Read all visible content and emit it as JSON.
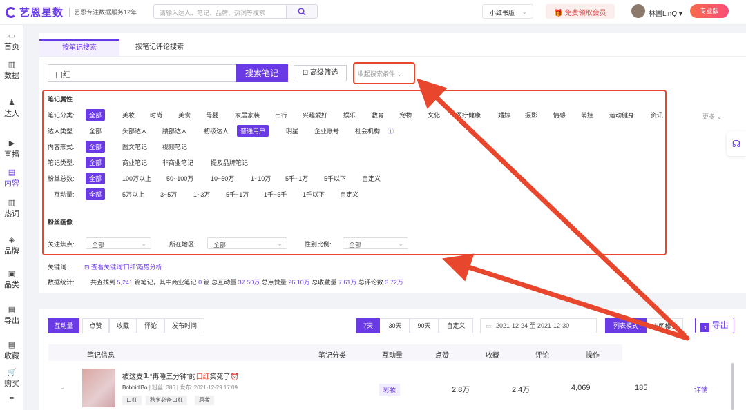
{
  "header": {
    "logo": "艺恩星数",
    "slogan": "艺恩专注数据服务12年",
    "search_placeholder": "请输入达人、笔记、品牌、热词等搜索",
    "platform": "小红书版",
    "vip": "免费领取会员",
    "user": "林圃LinQ",
    "pro_badge": "专业版"
  },
  "sidebar": [
    {
      "label": "首页",
      "icon": "monitor-icon"
    },
    {
      "label": "数据",
      "icon": "bar-chart-icon"
    },
    {
      "label": "达人",
      "icon": "person-icon"
    },
    {
      "label": "直播",
      "icon": "play-icon"
    },
    {
      "label": "内容",
      "icon": "document-icon"
    },
    {
      "label": "热词",
      "icon": "trend-icon"
    },
    {
      "label": "品牌",
      "icon": "diamond-icon"
    },
    {
      "label": "品类",
      "icon": "box-icon"
    },
    {
      "label": "导出",
      "icon": "export-icon"
    },
    {
      "label": "收藏",
      "icon": "bookmark-icon"
    },
    {
      "label": "购买",
      "icon": "cart-icon"
    },
    {
      "label": "",
      "icon": "list-icon"
    }
  ],
  "tabs": [
    "按笔记搜索",
    "按笔记评论搜索"
  ],
  "search": {
    "keyword": "口红",
    "search_btn": "搜索笔记",
    "advanced_btn": "高级筛选",
    "collapse": "收起搜索条件"
  },
  "filters": {
    "section_title": "笔记属性",
    "category": {
      "label": "笔记分类:",
      "options": [
        "全部",
        "美妆",
        "时尚",
        "美食",
        "母婴",
        "家居家装",
        "出行",
        "兴趣爱好",
        "娱乐",
        "教育",
        "宠物",
        "文化",
        "医疗健康",
        "婚嫁",
        "摄影",
        "情感",
        "萌娃",
        "运动健身",
        "资讯"
      ],
      "more": "更多"
    },
    "talent": {
      "label": "达人类型:",
      "options": [
        "全部",
        "头部达人",
        "腰部达人",
        "初级达人",
        "普通用户",
        "明星",
        "企业账号",
        "社会机构"
      ]
    },
    "format": {
      "label": "内容形式:",
      "options": [
        "全部",
        "图文笔记",
        "视频笔记"
      ]
    },
    "note_type": {
      "label": "笔记类型:",
      "options": [
        "全部",
        "商业笔记",
        "非商业笔记",
        "提及品牌笔记"
      ]
    },
    "fans": {
      "label": "粉丝总数:",
      "options": [
        "全部",
        "100万以上",
        "50~100万",
        "10~50万",
        "1~10万",
        "5千~1万",
        "5千以下",
        "自定义"
      ]
    },
    "interaction": {
      "label": "互动量:",
      "options": [
        "全部",
        "5万以上",
        "3~5万",
        "1~3万",
        "5千~1万",
        "1千~5千",
        "1千以下",
        "自定义"
      ]
    },
    "fan_profile": "粉丝画像",
    "focus": {
      "label": "关注焦点:",
      "value": "全部"
    },
    "region": {
      "label": "所在地区:",
      "value": "全部"
    },
    "gender": {
      "label": "性别比例:",
      "value": "全部"
    }
  },
  "keyword_row": {
    "label": "关键词:",
    "link": "查看关键词'口红'趋势分析"
  },
  "stats": {
    "label": "数据统计:",
    "p1": "共查找到",
    "notes": "5,241",
    "p2": "篇笔记，其中商业笔记",
    "biz": "0",
    "p3": "篇  总互动量",
    "inter": "37.50万",
    "p4": "总点赞量",
    "likes": "26.10万",
    "p5": "总收藏量",
    "fav": "7.61万",
    "p6": "总评论数",
    "comm": "3.72万"
  },
  "sort_tabs": [
    "互动量",
    "点赞",
    "收藏",
    "评论",
    "发布时间"
  ],
  "range_tabs": [
    "7天",
    "30天",
    "90天",
    "自定义"
  ],
  "date_range": "2021-12-24  至  2021-12-30",
  "view_modes": [
    "列表模式",
    "大图模式"
  ],
  "export": "导出",
  "table": {
    "headers": [
      "笔记信息",
      "笔记分类",
      "互动量",
      "点赞",
      "收藏",
      "评论",
      "操作"
    ],
    "row": {
      "title_pre": "被这支叫“再睡五分钟”的",
      "title_kw": "口红",
      "title_post": "笑死了⏰",
      "author": "BobbidiBo",
      "meta": "| 粉丝: 386 | 发布: 2021-12-29 17:09",
      "tags": [
        "口红",
        "秋冬必备口红",
        "唇妆"
      ],
      "category": "彩妆",
      "interaction": "2.8万",
      "likes": "2.4万",
      "fav": "4,069",
      "comments": "185",
      "action": "详情"
    }
  },
  "colors": {
    "accent": "#6a3be4",
    "annotation": "#e8472d"
  }
}
